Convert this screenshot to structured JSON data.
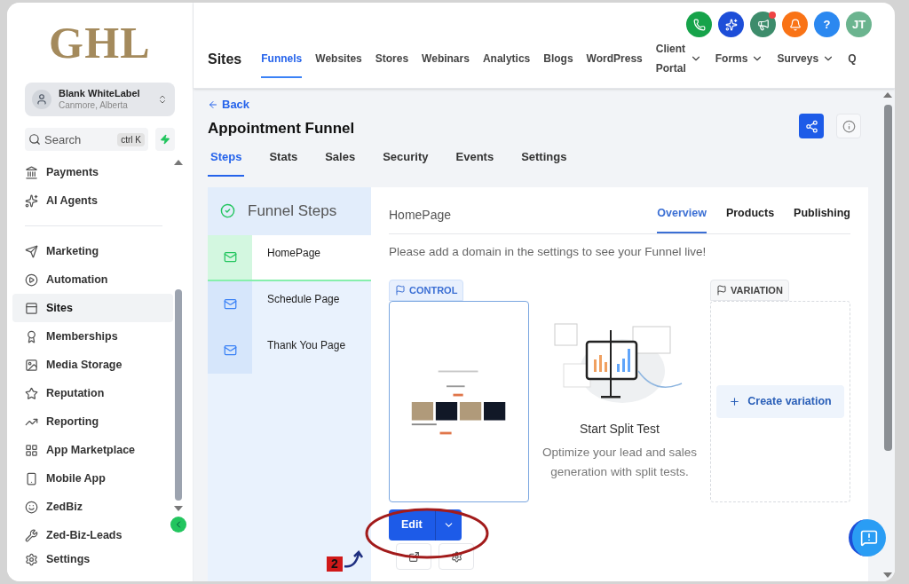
{
  "sidebar": {
    "logo": "GHL",
    "account": {
      "name": "Blank WhiteLabel",
      "location": "Canmore, Alberta"
    },
    "search": {
      "placeholder": "Search",
      "shortcut": "ctrl K"
    },
    "items": [
      {
        "label": "Payments",
        "kind": "payments",
        "selected": false
      },
      {
        "label": "AI Agents",
        "kind": "ai",
        "selected": false
      },
      {
        "label": "Marketing",
        "kind": "marketing",
        "selected": false,
        "divider_before": true
      },
      {
        "label": "Automation",
        "kind": "automation",
        "selected": false
      },
      {
        "label": "Sites",
        "kind": "sites",
        "selected": true
      },
      {
        "label": "Memberships",
        "kind": "memberships",
        "selected": false
      },
      {
        "label": "Media Storage",
        "kind": "media",
        "selected": false
      },
      {
        "label": "Reputation",
        "kind": "reputation",
        "selected": false
      },
      {
        "label": "Reporting",
        "kind": "reporting",
        "selected": false
      },
      {
        "label": "App Marketplace",
        "kind": "apps",
        "selected": false
      },
      {
        "label": "Mobile App",
        "kind": "mobile",
        "selected": false
      },
      {
        "label": "ZedBiz",
        "kind": "zedbiz",
        "selected": false
      },
      {
        "label": "Zed-Biz-Leads",
        "kind": "wrench",
        "selected": false
      }
    ],
    "settings": "Settings"
  },
  "header": {
    "title": "Sites",
    "nav": [
      {
        "label": "Funnels",
        "selected": true,
        "dropdown": false
      },
      {
        "label": "Websites",
        "selected": false,
        "dropdown": false
      },
      {
        "label": "Stores",
        "selected": false,
        "dropdown": false
      },
      {
        "label": "Webinars",
        "selected": false,
        "dropdown": false
      },
      {
        "label": "Analytics",
        "selected": false,
        "dropdown": false
      },
      {
        "label": "Blogs",
        "selected": false,
        "dropdown": false
      },
      {
        "label": "WordPress",
        "selected": false,
        "dropdown": false
      },
      {
        "label": "Client Portal",
        "selected": false,
        "dropdown": true
      },
      {
        "label": "Forms",
        "selected": false,
        "dropdown": true
      },
      {
        "label": "Surveys",
        "selected": false,
        "dropdown": true
      },
      {
        "label": "Q",
        "selected": false,
        "dropdown": false
      }
    ],
    "actions": [
      {
        "kind": "phone",
        "color": "#16a34a"
      },
      {
        "kind": "sparkle",
        "color": "#1d4ed8"
      },
      {
        "kind": "megaphone",
        "color": "#3d8c6b",
        "notification": true
      },
      {
        "kind": "bell",
        "color": "#f97316"
      },
      {
        "kind": "help",
        "color": "#2b88f0",
        "label": "?"
      },
      {
        "kind": "avatar",
        "color": "#6bb48f",
        "label": "JT"
      }
    ]
  },
  "funnel": {
    "back": "Back",
    "title": "Appointment Funnel",
    "tabs": [
      {
        "label": "Steps",
        "selected": true
      },
      {
        "label": "Stats",
        "selected": false
      },
      {
        "label": "Sales",
        "selected": false
      },
      {
        "label": "Security",
        "selected": false
      },
      {
        "label": "Events",
        "selected": false
      },
      {
        "label": "Settings",
        "selected": false
      }
    ],
    "steps_title": "Funnel Steps",
    "steps": [
      {
        "label": "HomePage",
        "selected": true
      },
      {
        "label": "Schedule Page",
        "selected": false
      },
      {
        "label": "Thank You Page",
        "selected": false
      }
    ]
  },
  "page": {
    "title": "HomePage",
    "tabs": [
      {
        "label": "Overview",
        "selected": true
      },
      {
        "label": "Products",
        "selected": false
      },
      {
        "label": "Publishing",
        "selected": false
      }
    ],
    "notice": "Please add a domain in the settings to see your Funnel live!",
    "control_label": "CONTROL",
    "variation_label": "VARIATION",
    "split_title": "Start Split Test",
    "split_text": "Optimize your lead and sales generation with split tests.",
    "create_variation": "Create variation",
    "edit": "Edit"
  },
  "annotation": {
    "label": "2"
  }
}
